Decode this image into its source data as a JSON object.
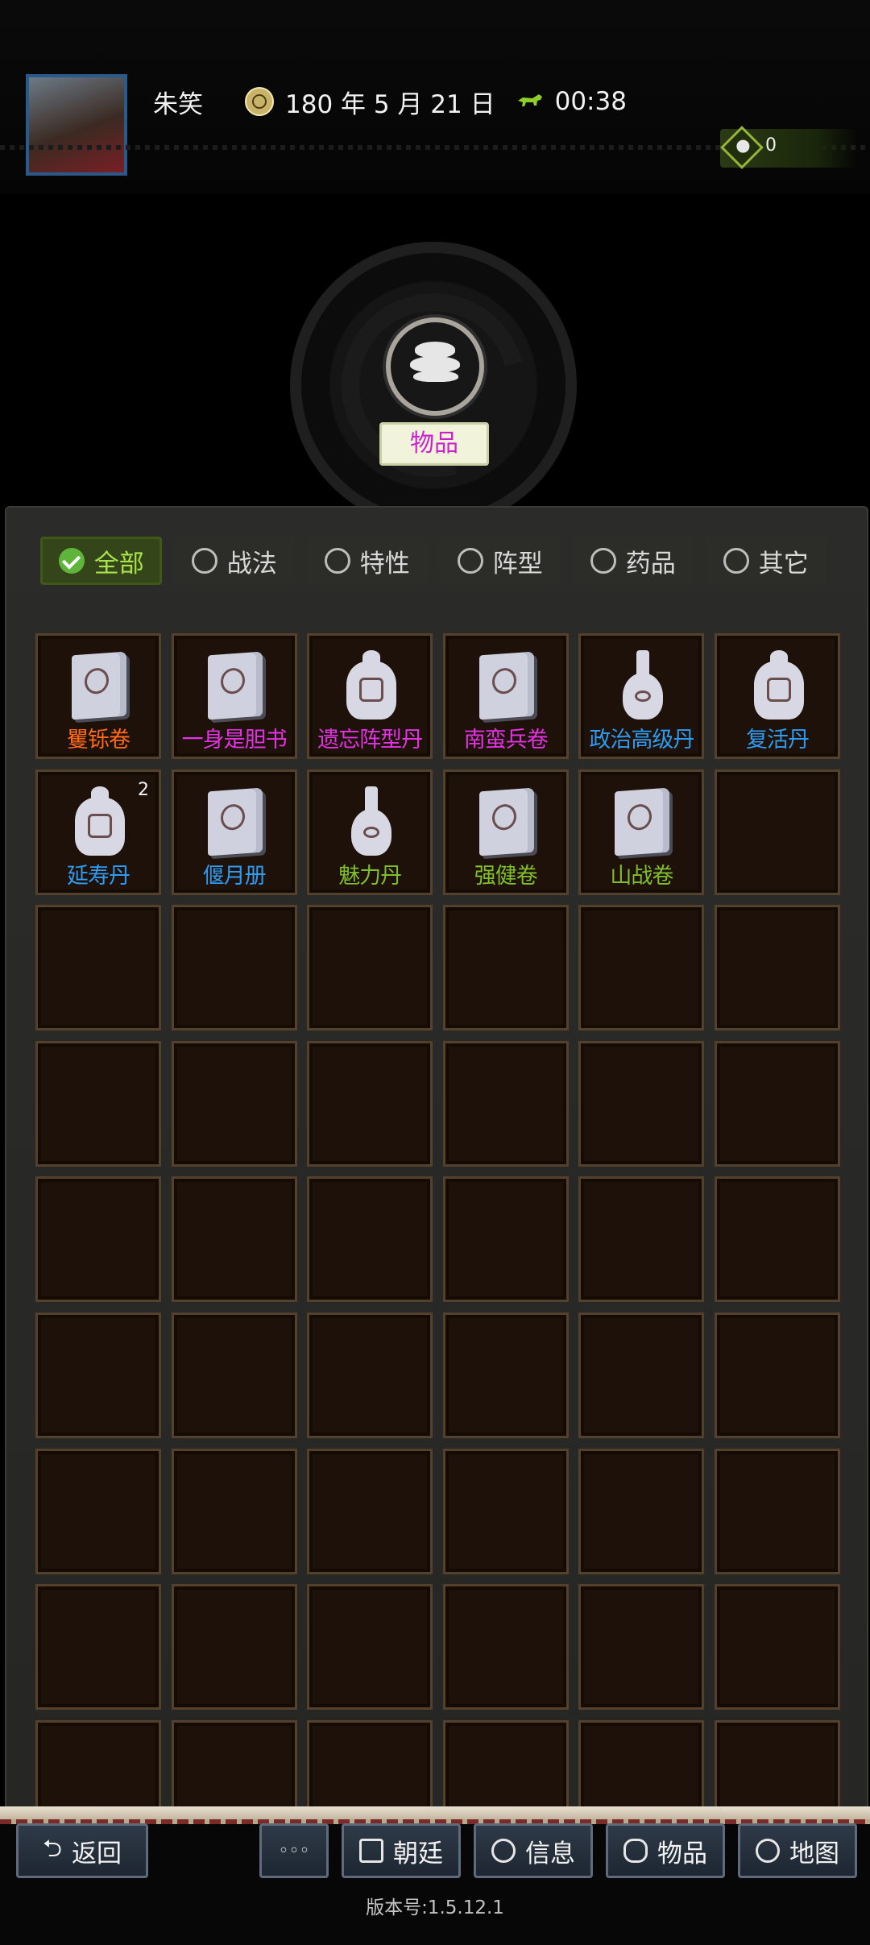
{
  "header": {
    "player_name": "朱笑",
    "date": "180 年 5 月 21 日",
    "time": "00:38",
    "currency_value": "0",
    "icons": [
      "portrait-avatar",
      "sun-dial-icon",
      "horse-icon",
      "money-bag-gem-icon"
    ]
  },
  "category": {
    "label": "物品",
    "icon": "items-icon"
  },
  "filters": [
    {
      "label": "全部",
      "active": true
    },
    {
      "label": "战法",
      "active": false
    },
    {
      "label": "特性",
      "active": false
    },
    {
      "label": "阵型",
      "active": false
    },
    {
      "label": "药品",
      "active": false
    },
    {
      "label": "其它",
      "active": false
    }
  ],
  "items": [
    {
      "name": "矍铄卷",
      "color": "#ff6a1a",
      "icon": "book",
      "count": ""
    },
    {
      "name": "一身是胆书",
      "color": "#e233e2",
      "icon": "book",
      "count": ""
    },
    {
      "name": "遗忘阵型丹",
      "color": "#e233e2",
      "icon": "jar",
      "count": ""
    },
    {
      "name": "南蛮兵卷",
      "color": "#e233e2",
      "icon": "book",
      "count": ""
    },
    {
      "name": "政治高级丹",
      "color": "#2e9cf0",
      "icon": "vase",
      "count": ""
    },
    {
      "name": "复活丹",
      "color": "#2e9cf0",
      "icon": "jar",
      "count": ""
    },
    {
      "name": "延寿丹",
      "color": "#2e9cf0",
      "icon": "jar",
      "count": "2"
    },
    {
      "name": "偃月册",
      "color": "#2e9cf0",
      "icon": "book",
      "count": ""
    },
    {
      "name": "魅力丹",
      "color": "#7fbf2a",
      "icon": "vase",
      "count": ""
    },
    {
      "name": "强健卷",
      "color": "#7fbf2a",
      "icon": "book",
      "count": ""
    },
    {
      "name": "山战卷",
      "color": "#7fbf2a",
      "icon": "book",
      "count": ""
    }
  ],
  "grid": {
    "columns": 6,
    "total_cells": 54
  },
  "bottom_nav": {
    "back": "返回",
    "more": "◦◦◦",
    "court": "朝廷",
    "info": "信息",
    "items": "物品",
    "map": "地图"
  },
  "version": "版本号:1.5.12.1"
}
